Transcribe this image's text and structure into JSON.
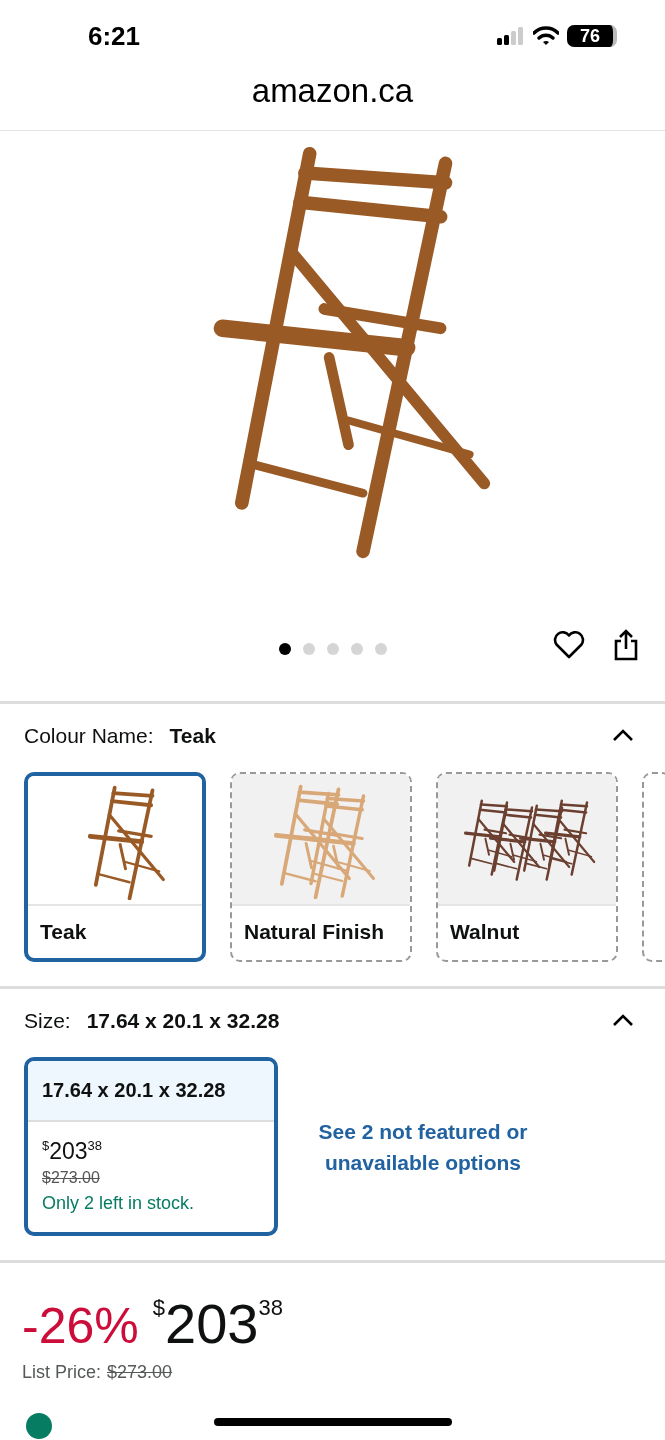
{
  "status_bar": {
    "time": "6:21",
    "battery": "76"
  },
  "url_bar": {
    "domain": "amazon.ca"
  },
  "gallery": {
    "dots": [
      {
        "selected": true
      },
      {
        "selected": false
      },
      {
        "selected": false
      },
      {
        "selected": false
      },
      {
        "selected": false
      }
    ]
  },
  "colour": {
    "label": "Colour Name:",
    "value": "Teak",
    "expanded": true,
    "swatches": [
      {
        "name": "Teak",
        "selected": true,
        "kind": "single",
        "color": "#9a5a26"
      },
      {
        "name": "Natural Finish",
        "selected": false,
        "kind": "stack",
        "color": "#d9a878"
      },
      {
        "name": "Walnut",
        "selected": false,
        "kind": "set",
        "color": "#6b4030"
      }
    ]
  },
  "size": {
    "label": "Size:",
    "value": "17.64 x 20.1 x 32.28",
    "expanded": true,
    "options": [
      {
        "name": "17.64 x 20.1 x 32.28",
        "selected": true,
        "price_symbol": "$",
        "price_whole": "203",
        "price_fraction": "38",
        "list_price": "$273.00",
        "stock": "Only 2 left in stock."
      }
    ],
    "more_link": "See 2 not featured or unavailable options"
  },
  "price": {
    "discount": "-26%",
    "symbol": "$",
    "whole": "203",
    "fraction": "38",
    "list_label": "List Price:",
    "list_price": "$273.00"
  }
}
